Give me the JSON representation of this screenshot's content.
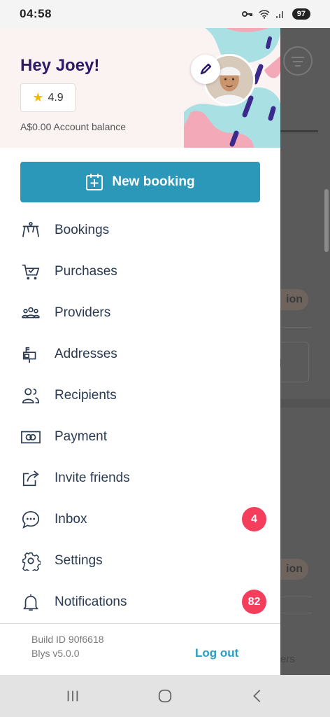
{
  "status_bar": {
    "time": "04:58",
    "battery": "97"
  },
  "drawer": {
    "greeting": "Hey Joey!",
    "rating": "4.9",
    "balance": "A$0.00 Account balance",
    "new_booking_label": "New booking",
    "menu": [
      {
        "label": "Bookings",
        "icon": "massage-table-icon"
      },
      {
        "label": "Purchases",
        "icon": "cart-icon"
      },
      {
        "label": "Providers",
        "icon": "group-icon"
      },
      {
        "label": "Addresses",
        "icon": "mailbox-icon"
      },
      {
        "label": "Recipients",
        "icon": "people-icon"
      },
      {
        "label": "Payment",
        "icon": "cash-icon"
      },
      {
        "label": "Invite friends",
        "icon": "share-icon"
      },
      {
        "label": "Inbox",
        "icon": "chat-icon",
        "badge": "4"
      },
      {
        "label": "Settings",
        "icon": "gear-icon"
      },
      {
        "label": "Notifications",
        "icon": "bell-icon",
        "badge": "82"
      }
    ],
    "build_id": "Build ID 90f6618",
    "version": "Blys v5.0.0",
    "logout_label": "Log out"
  },
  "background_app": {
    "pill_1": "ion",
    "card_1": "g",
    "pill_2": "ion",
    "footer_text": "ers"
  },
  "colors": {
    "primary": "#2b97b9",
    "greeting": "#2c1a66",
    "badge": "#f43e5c",
    "link": "#2a9dc0"
  }
}
